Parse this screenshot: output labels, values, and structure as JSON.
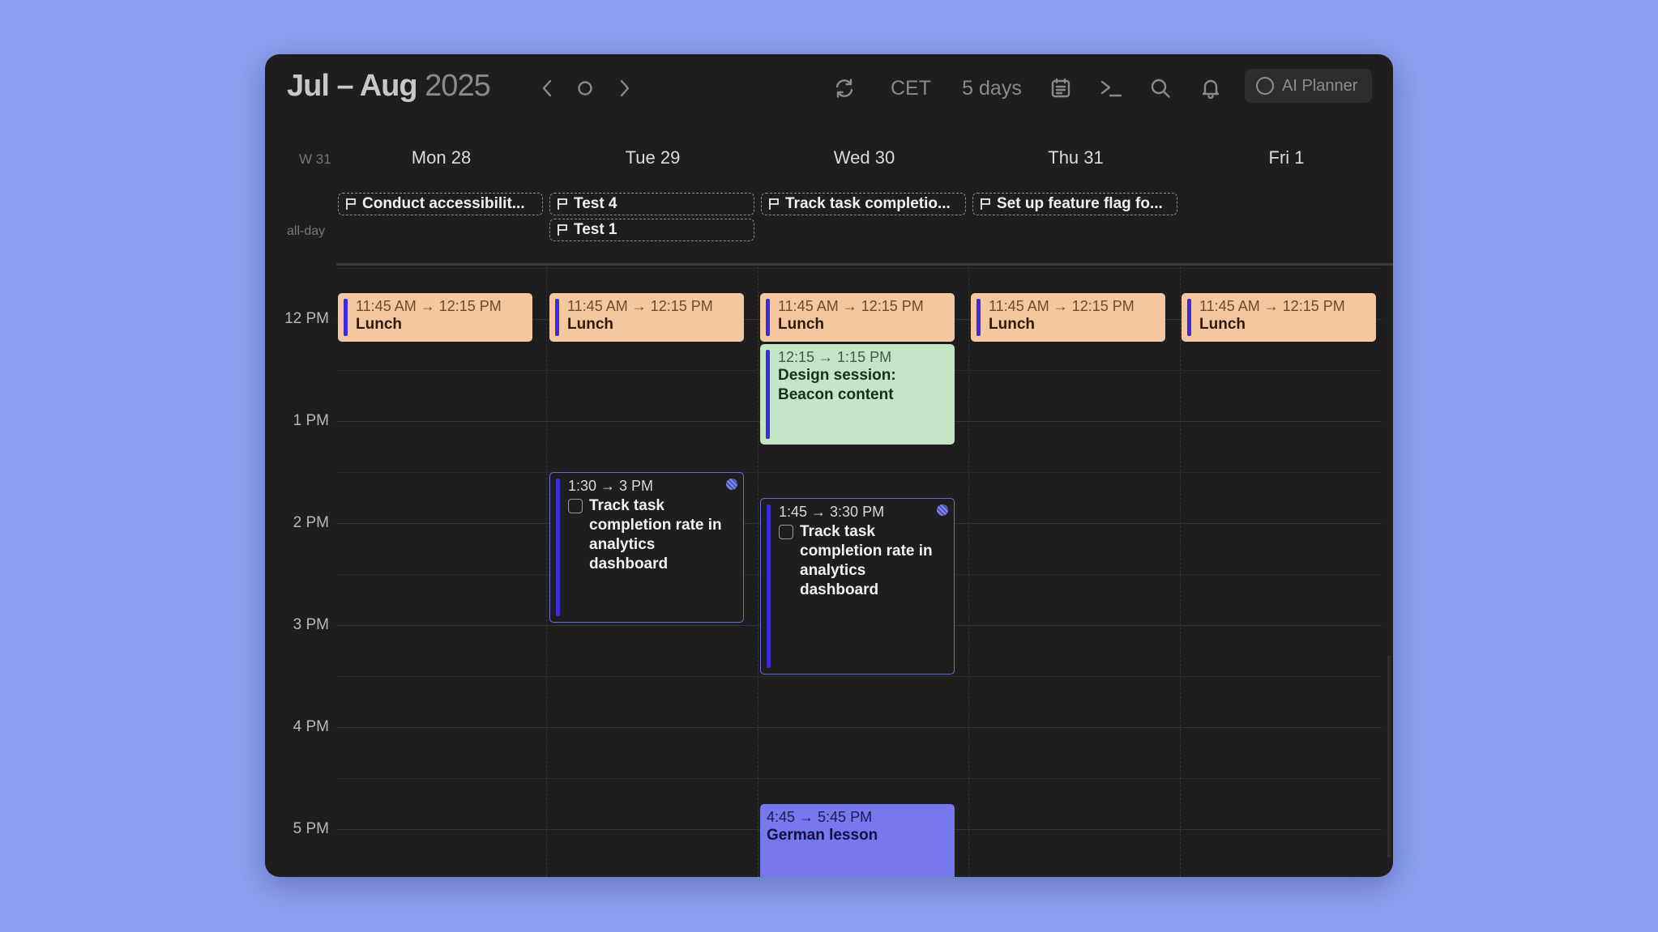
{
  "header": {
    "title_months": "Jul – Aug",
    "title_year": "2025",
    "timezone_label": "CET",
    "view_label": "5 days",
    "ai_planner_label": "AI Planner"
  },
  "week": {
    "label": "W 31",
    "all_day_label": "all-day",
    "days": [
      "Mon 28",
      "Tue 29",
      "Wed 30",
      "Thu 31",
      "Fri 1"
    ]
  },
  "all_day_events": [
    {
      "title": "Conduct accessibilit..."
    },
    {
      "title": "Test 4"
    },
    {
      "title": "Test 1"
    },
    {
      "title": "Track task completio..."
    },
    {
      "title": "Set up feature flag fo..."
    }
  ],
  "hours": [
    "12 PM",
    "1 PM",
    "2 PM",
    "3 PM",
    "4 PM",
    "5 PM"
  ],
  "events": [
    {
      "time": "11:45 AM → 12:15 PM",
      "title": "Lunch"
    },
    {
      "time": "11:45 AM → 12:15 PM",
      "title": "Lunch"
    },
    {
      "time": "11:45 AM → 12:15 PM",
      "title": "Lunch"
    },
    {
      "time": "11:45 AM → 12:15 PM",
      "title": "Lunch"
    },
    {
      "time": "11:45 AM → 12:15 PM",
      "title": "Lunch"
    },
    {
      "time": "12:15 → 1:15 PM",
      "title": "Design session: Beacon content"
    },
    {
      "time": "1:30 → 3 PM",
      "title": "Track task completion rate in analytics dashboard"
    },
    {
      "time": "1:45 → 3:30 PM",
      "title": "Track task completion rate in analytics dashboard"
    },
    {
      "time": "4:45 → 5:45 PM",
      "title": "German lesson"
    }
  ],
  "colors": {
    "background": "#8c9ff0",
    "window": "#1e1e1e",
    "lunch": "#f4c79e",
    "design": "#c6e4c6",
    "german": "#7777ee",
    "task_border": "#6a6ae6",
    "accent_bar": "#3d2bdc"
  },
  "icons": [
    "chevron-left-icon",
    "circle-today-icon",
    "chevron-right-icon",
    "refresh-icon",
    "calendar-icon",
    "terminal-icon",
    "search-icon",
    "bell-icon",
    "flag-icon"
  ]
}
